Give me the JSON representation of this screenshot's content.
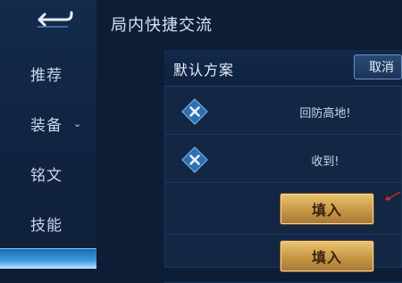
{
  "header": {
    "title": "局内快捷交流"
  },
  "sidebar": {
    "items": [
      {
        "label": "推荐"
      },
      {
        "label": "装备"
      },
      {
        "label": "铭文"
      },
      {
        "label": "技能"
      }
    ]
  },
  "panel": {
    "title": "默认方案",
    "cancel_label": "取消",
    "messages": [
      {
        "text": "回防高地!"
      },
      {
        "text": "收到!"
      }
    ],
    "fill_label": "填入"
  },
  "colors": {
    "accent_gold": "#c79746",
    "background": "#0e1d36",
    "active_tab": "#3e9be0"
  }
}
